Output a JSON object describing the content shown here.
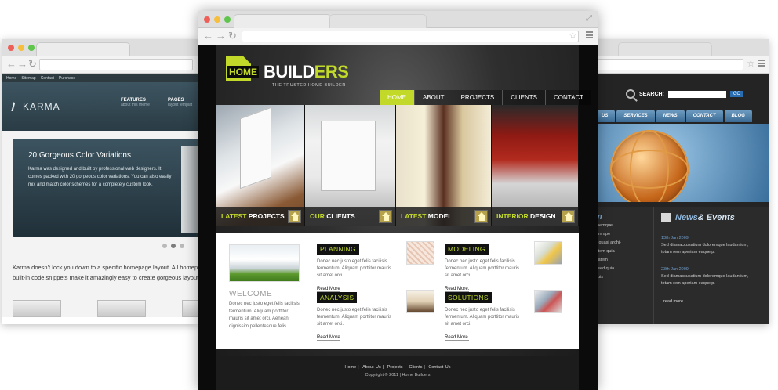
{
  "left_window": {
    "topnav": [
      "Home",
      "Sitemap",
      "Contact",
      "Purchase"
    ],
    "logo": "KARMA",
    "menu": [
      {
        "label": "FEATURES",
        "sub": "about this theme"
      },
      {
        "label": "PAGES",
        "sub": "layout templat"
      }
    ],
    "slider": {
      "title": "20 Gorgeous Color Variations",
      "text": "Karma was designed and built by professional web designers. It comes packed with 20 gorgeous color variations. You can also easily mix and match color schemes for a completely custom look."
    },
    "paragraph": "Karma doesn't lock you down to a specific homepage layout. All homep built-in code snippets make it amazingly easy to create gorgeous layout"
  },
  "right_window": {
    "search_label": "SEARCH:",
    "search_button": "GO",
    "nav": [
      "US",
      "SERVICES",
      "NEWS",
      "CONTACT",
      "BLOG"
    ],
    "col1_heading": "m",
    "col1_lines": [
      "onemque",
      "rem ape",
      "si quasi archi-",
      "tatem quia",
      "ptatem",
      "s sed quia",
      "Duis",
      "s"
    ],
    "news_title": {
      "part1": "News",
      "part2": "& Events"
    },
    "news": [
      {
        "date": "13th Jan 2009",
        "text": "Sed diamaccusatium doloremque laudantium, totam rem aperiam eaqueip."
      },
      {
        "date": "23th Jan 2009",
        "text": "Sed diamaccusatium doloremque laudantium, totam rem aperiam eaqueip."
      }
    ],
    "read_more": "read more"
  },
  "center_window": {
    "logo": {
      "home": "HOME",
      "builders_main": "BUILD",
      "builders_accent": "ERS",
      "tagline": "THE TRUSTED HOME BUILDER"
    },
    "nav": [
      "HOME",
      "ABOUT",
      "PROJECTS",
      "CLIENTS",
      "CONTACT"
    ],
    "gallery": [
      {
        "accent": "LATEST",
        "rest": " PROJECTS"
      },
      {
        "accent": "OUR",
        "rest": " CLIENTS"
      },
      {
        "accent": "LATEST",
        "rest": " MODEL"
      },
      {
        "accent": "INTERIOR",
        "rest": " DESIGN"
      }
    ],
    "welcome": {
      "title": "WELCOME",
      "text": "Donec nec justo eget felis facilisis fermentum. Aliquam porttitor mauris sit amet orci. Aenean dignissim pellentesque felis."
    },
    "features": [
      {
        "title": "PLANNING",
        "text": "Donec nec justo eget felis facilisis fermentum. Aliquam porttitor mauris sit amet orci.",
        "more": "Read More"
      },
      {
        "title": "MODELING",
        "text": "Donec nec justo eget felis facilisis fermentum. Aliquam porttitor mauris sit amet orci.",
        "more": "Read More."
      },
      {
        "title": "ANALYSIS",
        "text": "Donec nec justo eget felis facilisis fermentum. Aliquam porttitor mauris sit amet orci.",
        "more": "Read More"
      },
      {
        "title": "SOLUTIONS",
        "text": "Donec nec justo eget felis facilisis fermentum. Aliquam porttitor mauris sit amet orci.",
        "more": "Read More."
      }
    ],
    "footer_links": [
      "Home",
      "About Us",
      "Projects",
      "Clients",
      "Contact Us"
    ],
    "copyright": "Copyright © 2011 | Home Builders"
  },
  "colors": {
    "accent_lime": "#c2d92a",
    "karma_blue": "#2a3c45",
    "right_dark": "#242424"
  }
}
